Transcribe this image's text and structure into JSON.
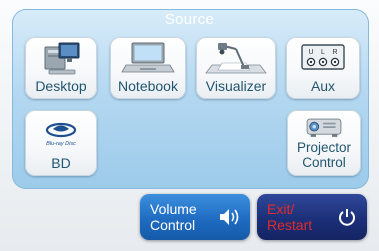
{
  "source": {
    "title": "Source",
    "tiles": [
      {
        "label": "Desktop",
        "icon": "desktop-computer-icon"
      },
      {
        "label": "Notebook",
        "icon": "notebook-laptop-icon"
      },
      {
        "label": "Visualizer",
        "icon": "document-camera-icon"
      },
      {
        "label": "Aux",
        "icon": "rca-jacks-icon",
        "jacks": [
          "U",
          "L",
          "R"
        ]
      },
      {
        "label": "BD",
        "icon": "bluray-disc-icon",
        "logo_text": "Blu-ray Disc"
      },
      {
        "label": "Projector Control",
        "label_lines": [
          "Projector",
          "Control"
        ],
        "icon": "projector-icon"
      }
    ]
  },
  "controls": {
    "volume": {
      "lines": [
        "Volume",
        "Control"
      ],
      "icon": "speaker-icon",
      "color": "#1f6cc2"
    },
    "exit": {
      "lines": [
        "Exit/",
        "Restart"
      ],
      "icon": "power-icon",
      "color": "#1c2f78",
      "text_color": "#e22b2b"
    }
  }
}
